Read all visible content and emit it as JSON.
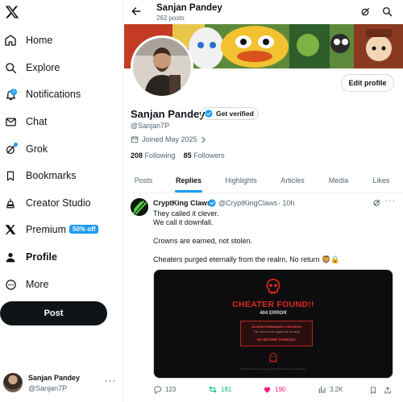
{
  "sidebar": {
    "logo": "x-logo-icon",
    "items": [
      {
        "label": "Home",
        "icon": "home-icon"
      },
      {
        "label": "Explore",
        "icon": "search-icon"
      },
      {
        "label": "Notifications",
        "icon": "bell-icon",
        "badge": "2"
      },
      {
        "label": "Chat",
        "icon": "mail-icon"
      },
      {
        "label": "Grok",
        "icon": "grok-icon"
      },
      {
        "label": "Bookmarks",
        "icon": "bookmark-icon"
      },
      {
        "label": "Creator Studio",
        "icon": "creator-studio-icon"
      },
      {
        "label": "Premium",
        "icon": "x-premium-icon",
        "tag": "50% off"
      },
      {
        "label": "Profile",
        "icon": "person-icon"
      },
      {
        "label": "More",
        "icon": "more-circle-icon"
      }
    ],
    "post_label": "Post",
    "account": {
      "name": "Sanjan Pandey",
      "handle": "@Sanjan7P",
      "more": "···"
    }
  },
  "header": {
    "name": "Sanjan Pandey",
    "posts": "262 posts"
  },
  "profile": {
    "name": "Sanjan Pandey",
    "get_verified": "Get verified",
    "handle": "@Sanjan7P",
    "joined": "Joined May 2025",
    "following_count": "208",
    "following_label": "Following",
    "followers_count": "85",
    "followers_label": "Followers",
    "edit_label": "Edit profile"
  },
  "tabs": [
    {
      "label": "Posts"
    },
    {
      "label": "Replies",
      "active": true
    },
    {
      "label": "Highlights"
    },
    {
      "label": "Articles"
    },
    {
      "label": "Media"
    },
    {
      "label": "Likes"
    }
  ],
  "tweet": {
    "author": "CryptKing Claws",
    "handle": "@CryptKingClaws",
    "time": "· 10h",
    "lines": [
      "They called it clever.",
      "We call it downfall.",
      "Crowns are earned, not stolen.",
      "Cheaters purged eternally from the realm, No return 🦁🔒"
    ],
    "media": {
      "title": "CHEATER FOUND!!",
      "error": "404 ERROR",
      "box_line1": "ACCESS PERMANENTLY REVOKED",
      "box_line2": "This account was flagged for cheating",
      "box_line3": "NO SECOND CHANCES.",
      "footer": "this action has been logged and enforced across all platforms"
    },
    "stats": {
      "replies": "123",
      "reposts": "181",
      "likes": "190",
      "views": "3.2K"
    }
  },
  "colors": {
    "accent": "#1d9bf0",
    "repost": "#00ba7c",
    "like": "#f91880",
    "cheater_red": "#e0281f"
  }
}
